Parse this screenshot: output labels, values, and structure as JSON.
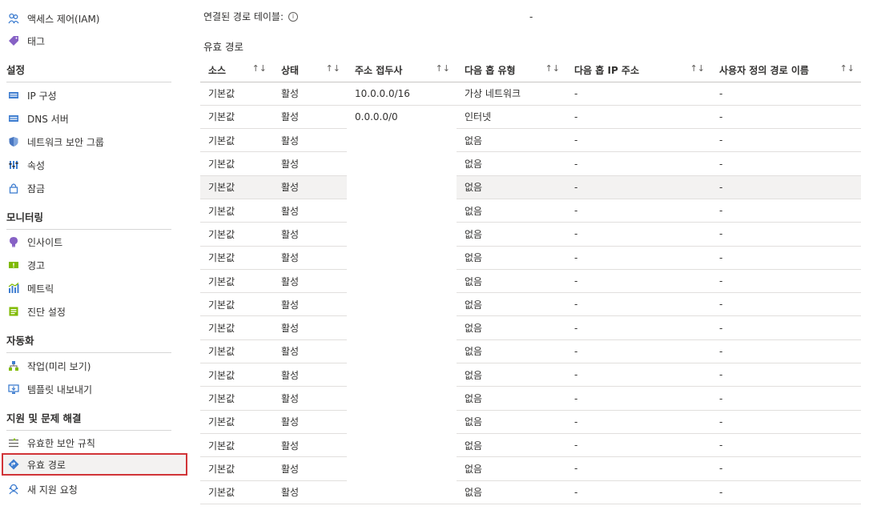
{
  "sidebar": {
    "top_items": [
      {
        "label": "액세스 제어(IAM)",
        "icon": "people-icon"
      },
      {
        "label": "태그",
        "icon": "tag-icon"
      }
    ],
    "sections": [
      {
        "title": "설정",
        "items": [
          {
            "label": "IP 구성",
            "icon": "ip-config-icon"
          },
          {
            "label": "DNS 서버",
            "icon": "dns-server-icon"
          },
          {
            "label": "네트워크 보안 그룹",
            "icon": "shield-icon"
          },
          {
            "label": "속성",
            "icon": "properties-icon"
          },
          {
            "label": "잠금",
            "icon": "lock-icon"
          }
        ]
      },
      {
        "title": "모니터링",
        "items": [
          {
            "label": "인사이트",
            "icon": "insights-icon"
          },
          {
            "label": "경고",
            "icon": "alert-icon"
          },
          {
            "label": "메트릭",
            "icon": "metrics-icon"
          },
          {
            "label": "진단 설정",
            "icon": "diagnostic-icon"
          }
        ]
      },
      {
        "title": "자동화",
        "items": [
          {
            "label": "작업(미리 보기)",
            "icon": "tasks-icon"
          },
          {
            "label": "템플릿 내보내기",
            "icon": "export-template-icon"
          }
        ]
      },
      {
        "title": "지원 및 문제 해결",
        "items": [
          {
            "label": "유효한 보안 규칙",
            "icon": "security-rules-icon"
          },
          {
            "label": "유효 경로",
            "icon": "routes-icon",
            "selected": true
          },
          {
            "label": "새 지원 요청",
            "icon": "support-icon"
          }
        ]
      }
    ]
  },
  "main": {
    "associated_label": "연결된 경로 테이블:",
    "associated_value": "-",
    "section_title": "유효 경로",
    "table": {
      "columns": [
        "소스",
        "상태",
        "주소 접두사",
        "다음 홉 유형",
        "다음 홉 IP 주소",
        "사용자 정의 경로 이름"
      ],
      "sort_glyph": "↑↓",
      "rows": [
        [
          "기본값",
          "활성",
          "10.0.0.0/16",
          "가상 네트워크",
          "-",
          "-"
        ],
        [
          "기본값",
          "활성",
          "0.0.0.0/0",
          "인터넷",
          "-",
          "-"
        ],
        [
          "기본값",
          "활성",
          "",
          "없음",
          "-",
          "-"
        ],
        [
          "기본값",
          "활성",
          "",
          "없음",
          "-",
          "-"
        ],
        [
          "기본값",
          "활성",
          "",
          "없음",
          "-",
          "-"
        ],
        [
          "기본값",
          "활성",
          "",
          "없음",
          "-",
          "-"
        ],
        [
          "기본값",
          "활성",
          "",
          "없음",
          "-",
          "-"
        ],
        [
          "기본값",
          "활성",
          "",
          "없음",
          "-",
          "-"
        ],
        [
          "기본값",
          "활성",
          "",
          "없음",
          "-",
          "-"
        ],
        [
          "기본값",
          "활성",
          "",
          "없음",
          "-",
          "-"
        ],
        [
          "기본값",
          "활성",
          "",
          "없음",
          "-",
          "-"
        ],
        [
          "기본값",
          "활성",
          "",
          "없음",
          "-",
          "-"
        ],
        [
          "기본값",
          "활성",
          "",
          "없음",
          "-",
          "-"
        ],
        [
          "기본값",
          "활성",
          "",
          "없음",
          "-",
          "-"
        ],
        [
          "기본값",
          "활성",
          "",
          "없음",
          "-",
          "-"
        ],
        [
          "기본값",
          "활성",
          "",
          "없음",
          "-",
          "-"
        ],
        [
          "기본값",
          "활성",
          "",
          "없음",
          "-",
          "-"
        ],
        [
          "기본값",
          "활성",
          "",
          "없음",
          "-",
          "-"
        ]
      ],
      "highlighted_row": 4
    }
  },
  "colors": {
    "selection_border": "#d13438",
    "tag_icon": "#8661c5",
    "shield_icon": "#4a78c2",
    "alert_icon": "#7fba00",
    "routes_icon": "#3f7ed0"
  }
}
